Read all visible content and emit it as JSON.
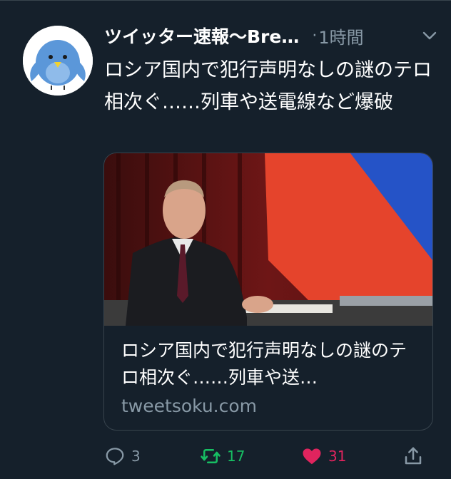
{
  "tweet": {
    "author": "ツイッター速報〜Bre…",
    "separator": "·",
    "time": "1時間",
    "text": "ロシア国内で犯行声明なしの謎のテロ相次ぐ……列車や送電線など爆破"
  },
  "card": {
    "title": "ロシア国内で犯行声明なしの謎のテロ相次ぐ……列車や送…",
    "domain": "tweetsoku.com"
  },
  "actions": {
    "reply_count": "3",
    "retweet_count": "17",
    "like_count": "31"
  },
  "icons": {
    "more": "chevron-down-icon",
    "reply": "reply-icon",
    "retweet": "retweet-icon",
    "like": "heart-icon",
    "share": "share-icon"
  },
  "colors": {
    "background": "#15202b",
    "secondary_text": "#8899a6",
    "retweet": "#17bf63",
    "like": "#e0245e",
    "border": "#38444d"
  }
}
